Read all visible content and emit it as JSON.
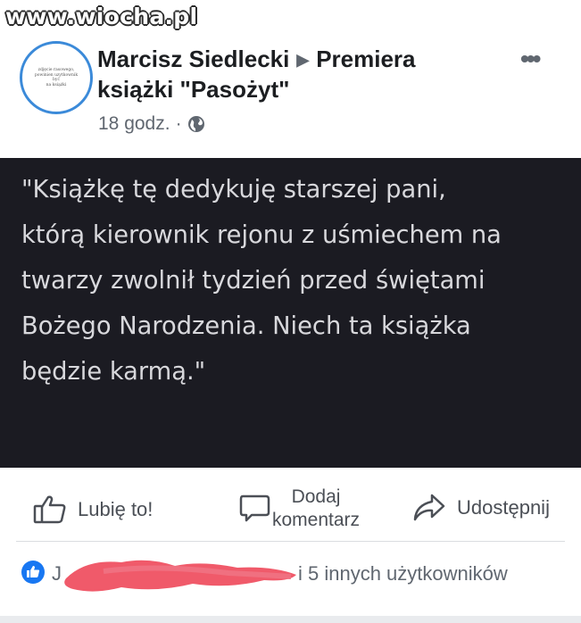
{
  "watermark": "www.wiocha.pl",
  "post": {
    "author": "Marcisz Siedlecki",
    "target": "Premiera książki \"Pasożyt\"",
    "time": "18 godz.",
    "dot": "·",
    "more": "•••",
    "avatar_text": [
      "zdjęcie rasowego,",
      "powinien uzytkownik być",
      "na książki"
    ]
  },
  "quote": {
    "text": "\"Książkę tę dedykuję starszej pani,\nktórą kierownik rejonu z uśmiechem na\ntwarzy zwolnił tydzień przed świętami\nBożego Narodzenia. Niech ta książka\nbędzie karmą.\""
  },
  "actions": {
    "like": "Lubię to!",
    "comment_line1": "Dodaj",
    "comment_line2": "komentarz",
    "share": "Udostępnij"
  },
  "reactions": {
    "first_initial": "J",
    "others": "i 5 innych użytkowników"
  },
  "colors": {
    "accent": "#1877f2",
    "quote_bg": "#1b1b22",
    "redaction": "#f05a6a"
  },
  "icons": [
    "globe-icon",
    "thumbs-up-icon",
    "comment-icon",
    "share-icon",
    "like-reaction-icon",
    "more-icon"
  ]
}
